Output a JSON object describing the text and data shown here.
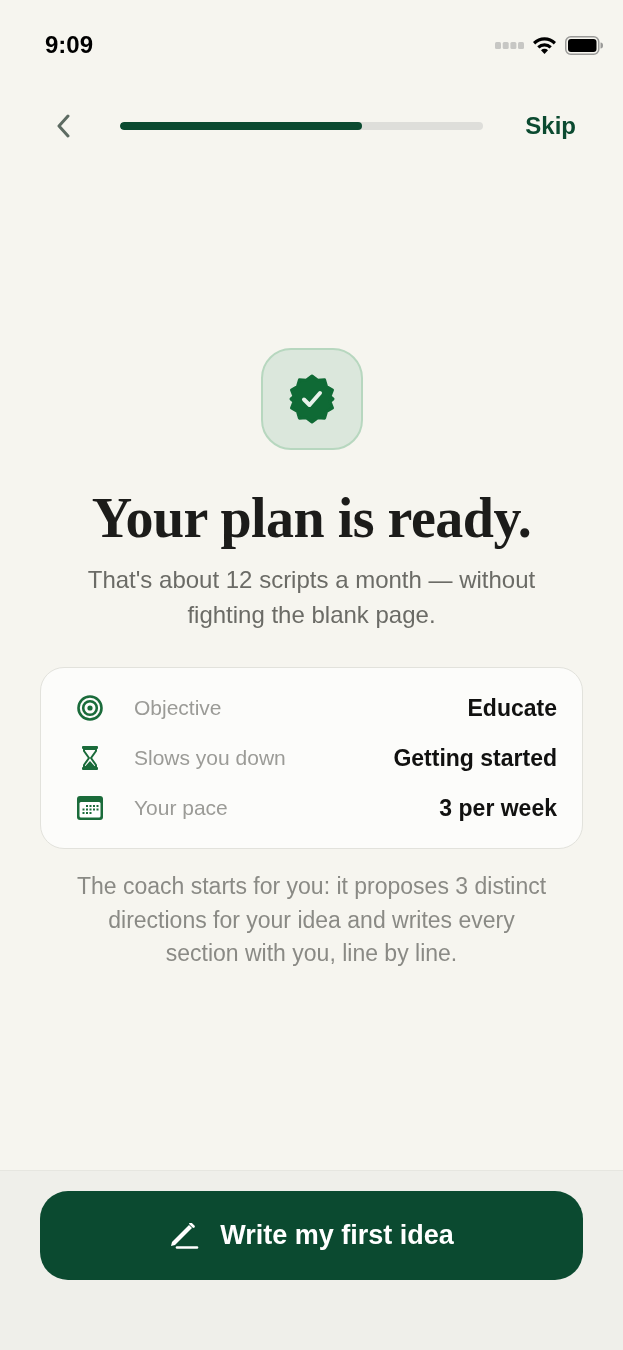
{
  "status_bar": {
    "time": "9:09"
  },
  "nav": {
    "progress": {
      "level": 0.667
    },
    "skip": "Skip"
  },
  "hero": {
    "title": "Your plan is ready.",
    "subtitle": "That's about 12 scripts a month — without fighting the blank page."
  },
  "summary": [
    {
      "label": "Objective",
      "value": "Educate"
    },
    {
      "label": "Slows you down",
      "value": "Getting started"
    },
    {
      "label": "Your pace",
      "value": "3 per week"
    }
  ],
  "note": "The coach starts for you: it proposes 3 distinct directions for your idea and writes every section with you, line by line.",
  "primary_button": {
    "label": "Write my first idea"
  }
}
